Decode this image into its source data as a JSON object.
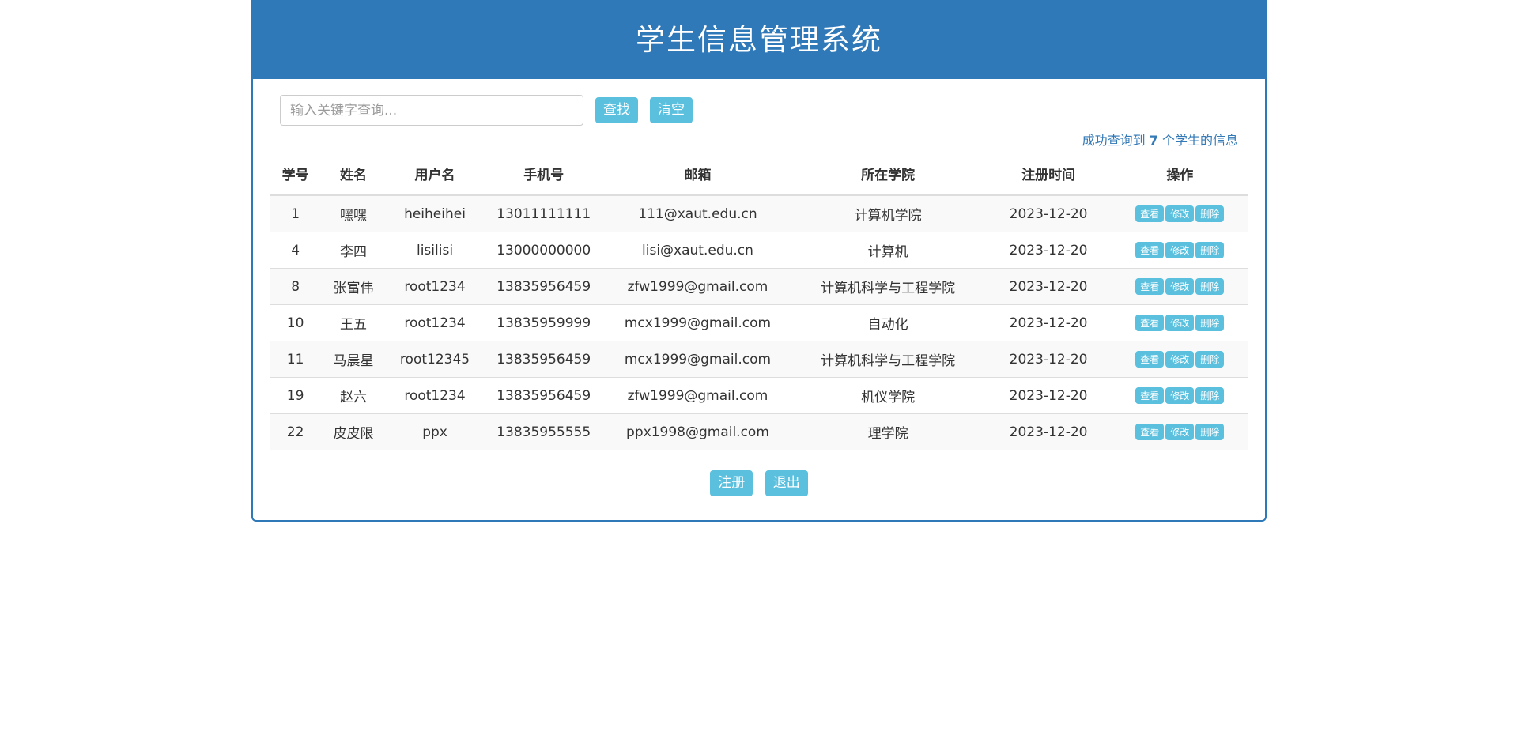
{
  "header": {
    "title": "学生信息管理系统",
    "background_color": "#3079b8"
  },
  "toolbar": {
    "search_placeholder": "输入关键字查询...",
    "search_value": "",
    "search_button_label": "查找",
    "clear_button_label": "清空",
    "button_color": "#5bc0de"
  },
  "result_message": {
    "prefix": "成功查询到 ",
    "count": "7",
    "suffix": " 个学生的信息",
    "color": "#337ab7"
  },
  "table": {
    "columns": [
      {
        "key": "id",
        "label": "学号"
      },
      {
        "key": "name",
        "label": "姓名"
      },
      {
        "key": "username",
        "label": "用户名"
      },
      {
        "key": "phone",
        "label": "手机号"
      },
      {
        "key": "email",
        "label": "邮箱"
      },
      {
        "key": "college",
        "label": "所在学院"
      },
      {
        "key": "register_time",
        "label": "注册时间"
      },
      {
        "key": "operations",
        "label": "操作"
      }
    ],
    "row_actions": {
      "view_label": "查看",
      "edit_label": "修改",
      "delete_label": "删除"
    },
    "rows": [
      {
        "id": "1",
        "name": "嘿嘿",
        "username": "heiheihei",
        "phone": "13011111111",
        "email": "111@xaut.edu.cn",
        "college": "计算机学院",
        "register_time": "2023-12-20"
      },
      {
        "id": "4",
        "name": "李四",
        "username": "lisilisi",
        "phone": "13000000000",
        "email": "lisi@xaut.edu.cn",
        "college": "计算机",
        "register_time": "2023-12-20"
      },
      {
        "id": "8",
        "name": "张富伟",
        "username": "root1234",
        "phone": "13835956459",
        "email": "zfw1999@gmail.com",
        "college": "计算机科学与工程学院",
        "register_time": "2023-12-20"
      },
      {
        "id": "10",
        "name": "王五",
        "username": "root1234",
        "phone": "13835959999",
        "email": "mcx1999@gmail.com",
        "college": "自动化",
        "register_time": "2023-12-20"
      },
      {
        "id": "11",
        "name": "马晨星",
        "username": "root12345",
        "phone": "13835956459",
        "email": "mcx1999@gmail.com",
        "college": "计算机科学与工程学院",
        "register_time": "2023-12-20"
      },
      {
        "id": "19",
        "name": "赵六",
        "username": "root1234",
        "phone": "13835956459",
        "email": "zfw1999@gmail.com",
        "college": "机仪学院",
        "register_time": "2023-12-20"
      },
      {
        "id": "22",
        "name": "皮皮限",
        "username": "ppx",
        "phone": "13835955555",
        "email": "ppx1998@gmail.com",
        "college": "理学院",
        "register_time": "2023-12-20"
      }
    ]
  },
  "footer": {
    "register_label": "注册",
    "logout_label": "退出"
  }
}
